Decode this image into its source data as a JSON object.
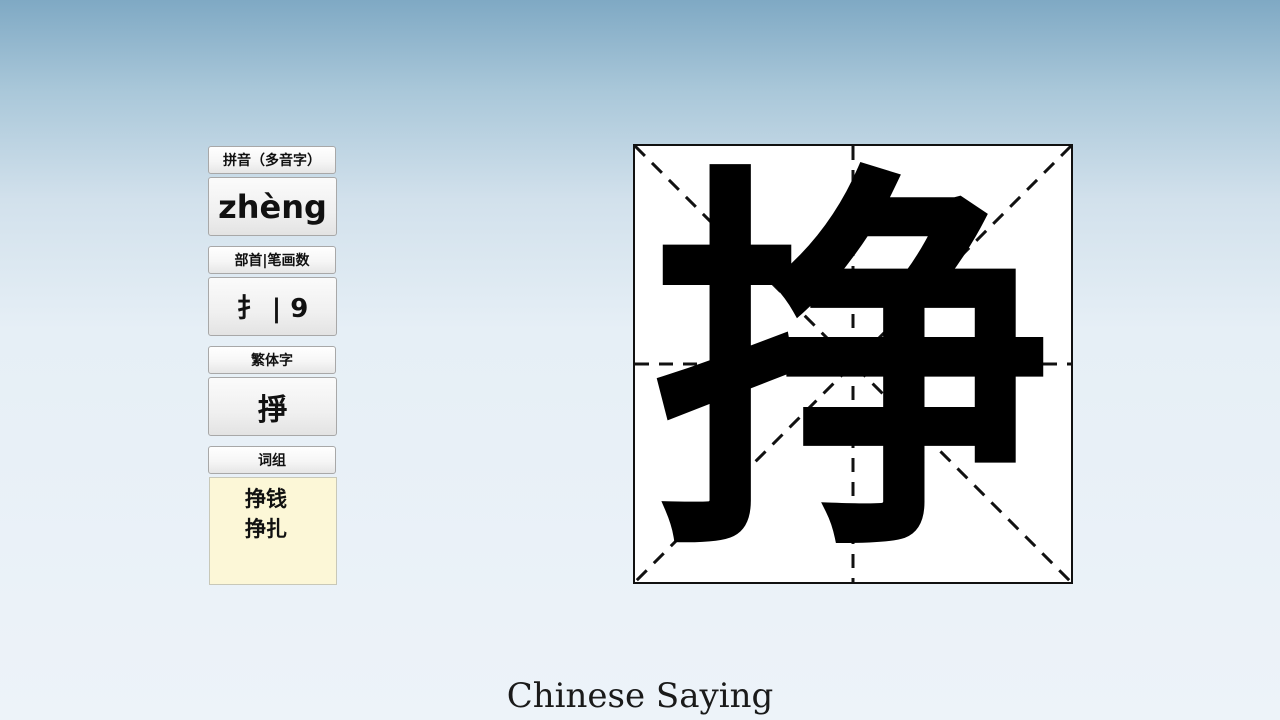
{
  "panel": {
    "pinyin_label": "拼音（多音字）",
    "pinyin_value": "zhèng",
    "radical_strokes_label": "部首|笔画数",
    "radical_strokes_value": "扌 | 9",
    "traditional_label": "繁体字",
    "traditional_value": "掙",
    "words_label": "词组",
    "words": [
      "挣钱",
      "挣扎"
    ]
  },
  "grid": {
    "character": "挣"
  },
  "caption": "Chinese Saying"
}
